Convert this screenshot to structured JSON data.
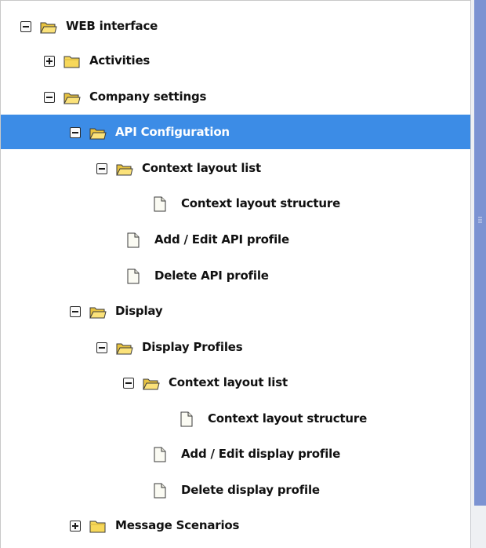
{
  "tree": {
    "items": [
      {
        "label": "WEB interface",
        "icon": "folder-open-icon",
        "toggle": "collapse"
      },
      {
        "label": "Activities",
        "icon": "folder-closed-icon",
        "toggle": "expand"
      },
      {
        "label": "Company settings",
        "icon": "folder-open-icon",
        "toggle": "collapse"
      },
      {
        "label": "API Configuration",
        "icon": "folder-open-icon",
        "toggle": "collapse",
        "selected": true
      },
      {
        "label": "Context layout list",
        "icon": "folder-open-icon",
        "toggle": "collapse"
      },
      {
        "label": "Context layout structure",
        "icon": "document-icon",
        "toggle": "none"
      },
      {
        "label": "Add / Edit API profile",
        "icon": "document-icon",
        "toggle": "none"
      },
      {
        "label": "Delete API profile",
        "icon": "document-icon",
        "toggle": "none"
      },
      {
        "label": "Display",
        "icon": "folder-open-icon",
        "toggle": "collapse"
      },
      {
        "label": "Display Profiles",
        "icon": "folder-open-icon",
        "toggle": "collapse"
      },
      {
        "label": "Context layout list",
        "icon": "folder-open-icon",
        "toggle": "collapse"
      },
      {
        "label": "Context layout structure",
        "icon": "document-icon",
        "toggle": "none"
      },
      {
        "label": "Add / Edit display profile",
        "icon": "document-icon",
        "toggle": "none"
      },
      {
        "label": "Delete display profile",
        "icon": "document-icon",
        "toggle": "none"
      },
      {
        "label": "Message Scenarios",
        "icon": "folder-closed-icon",
        "toggle": "expand"
      }
    ]
  },
  "colors": {
    "selection": "#3c8ce6",
    "splitter": "#7c93d2",
    "folder": "#f7d85a"
  }
}
